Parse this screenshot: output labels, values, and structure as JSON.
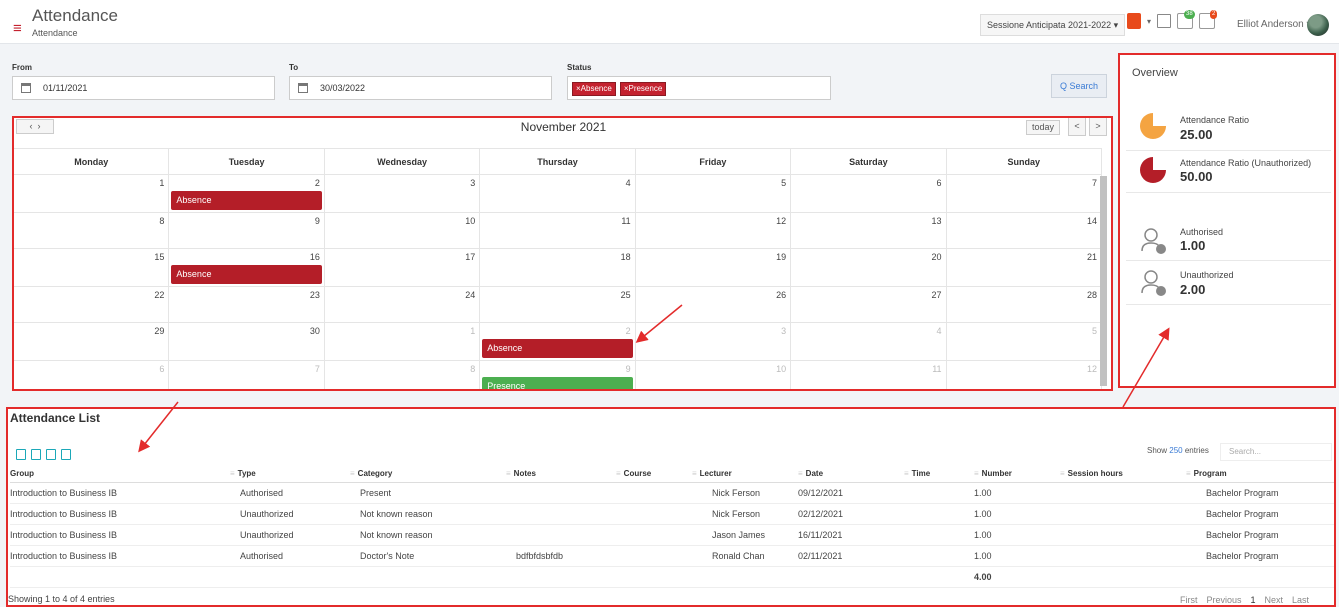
{
  "header": {
    "title": "Attendance",
    "subtitle": "Attendance",
    "session": "Sessione Anticipata 2021-2022",
    "badge1": "38",
    "badge2": "2",
    "user": "Elliot Anderson"
  },
  "filters": {
    "from_label": "From",
    "from_value": "01/11/2021",
    "to_label": "To",
    "to_value": "30/03/2022",
    "status_label": "Status",
    "status_chips": [
      "×Absence",
      "×Presence"
    ],
    "search_label": "Q Search"
  },
  "calendar": {
    "title": "November 2021",
    "today_label": "today",
    "prev": "<",
    "next": ">",
    "dow": [
      "Monday",
      "Tuesday",
      "Wednesday",
      "Thursday",
      "Friday",
      "Saturday",
      "Sunday"
    ],
    "weeks": [
      [
        "1",
        "2",
        "3",
        "4",
        "5",
        "6",
        "7"
      ],
      [
        "8",
        "9",
        "10",
        "11",
        "12",
        "13",
        "14"
      ],
      [
        "15",
        "16",
        "17",
        "18",
        "19",
        "20",
        "21"
      ],
      [
        "22",
        "23",
        "24",
        "25",
        "26",
        "27",
        "28"
      ],
      [
        "29",
        "30",
        "1",
        "2",
        "3",
        "4",
        "5"
      ],
      [
        "6",
        "7",
        "8",
        "9",
        "10",
        "11",
        "12"
      ]
    ],
    "events": {
      "e1": "Absence",
      "e2": "Absence",
      "e3": "Absence",
      "e4": "Presence"
    }
  },
  "overview": {
    "title": "Overview",
    "items": [
      {
        "label": "Attendance Ratio",
        "value": "25.00"
      },
      {
        "label": "Attendance Ratio (Unauthorized)",
        "value": "50.00"
      },
      {
        "label": "Authorised",
        "value": "1.00"
      },
      {
        "label": "Unauthorized",
        "value": "2.00"
      }
    ]
  },
  "list": {
    "title": "Attendance List",
    "show": "Show",
    "show_num": "250",
    "entries": "entries",
    "search_placeholder": "Search...",
    "columns": [
      "Group",
      "Type",
      "Category",
      "Notes",
      "Course",
      "Lecturer",
      "Date",
      "Time",
      "Number",
      "Session hours",
      "Program"
    ],
    "rows": [
      [
        "Introduction to Business IB",
        "Authorised",
        "Present",
        "",
        "",
        "Nick Ferson",
        "09/12/2021",
        "",
        "1.00",
        "",
        "Bachelor Program"
      ],
      [
        "Introduction to Business IB",
        "Unauthorized",
        "Not known reason",
        "",
        "",
        "Nick Ferson",
        "02/12/2021",
        "",
        "1.00",
        "",
        "Bachelor Program"
      ],
      [
        "Introduction to Business IB",
        "Unauthorized",
        "Not known reason",
        "",
        "",
        "Jason James",
        "16/11/2021",
        "",
        "1.00",
        "",
        "Bachelor Program"
      ],
      [
        "Introduction to Business IB",
        "Authorised",
        "Doctor's Note",
        "bdfbfdsbfdb",
        "",
        "Ronald Chan",
        "02/11/2021",
        "",
        "1.00",
        "",
        "Bachelor Program"
      ]
    ],
    "total": "4.00",
    "showing": "Showing 1 to 4 of 4 entries",
    "pager": {
      "first": "First",
      "previous": "Previous",
      "page": "1",
      "next": "Next",
      "last": "Last"
    }
  },
  "colors": {
    "accent": "#c4222f",
    "presence": "#4caf50",
    "highlight": "#e32b2b"
  }
}
